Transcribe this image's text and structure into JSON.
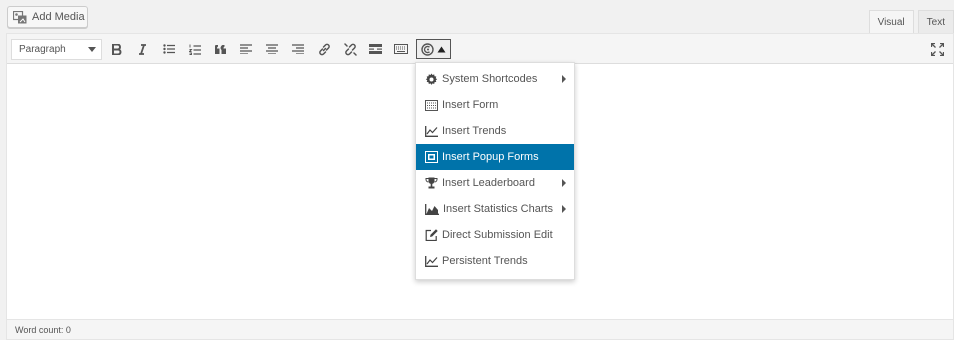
{
  "add_media": {
    "label": "Add Media",
    "icon": "add-media-icon"
  },
  "tabs": [
    {
      "label": "Visual",
      "active": true
    },
    {
      "label": "Text",
      "active": false
    }
  ],
  "toolbar": {
    "format": "Paragraph",
    "buttons": [
      "bold-icon",
      "italic-icon",
      "bullet-list-icon",
      "numbered-list-icon",
      "blockquote-icon",
      "align-left-icon",
      "align-center-icon",
      "align-right-icon",
      "link-icon",
      "unlink-icon",
      "read-more-icon",
      "toolbar-toggle-icon",
      "shortcode-menu-icon",
      "fullscreen-icon"
    ]
  },
  "menu": {
    "items": [
      {
        "label": "System Shortcodes",
        "icon": "gear-icon",
        "submenu": true
      },
      {
        "label": "Insert Form",
        "icon": "form-icon",
        "submenu": false
      },
      {
        "label": "Insert Trends",
        "icon": "line-chart-icon",
        "submenu": false
      },
      {
        "label": "Insert Popup Forms",
        "icon": "popup-icon",
        "submenu": false,
        "highlighted": true
      },
      {
        "label": "Insert Leaderboard",
        "icon": "trophy-icon",
        "submenu": true
      },
      {
        "label": "Insert Statistics Charts",
        "icon": "area-chart-icon",
        "submenu": true
      },
      {
        "label": "Direct Submission Edit",
        "icon": "edit-icon",
        "submenu": false
      },
      {
        "label": "Persistent Trends",
        "icon": "line-chart-icon",
        "submenu": false
      }
    ]
  },
  "status": {
    "word_count": "Word count: 0"
  },
  "colors": {
    "highlight": "#0073aa",
    "toolbar_bg": "#f5f5f5"
  }
}
